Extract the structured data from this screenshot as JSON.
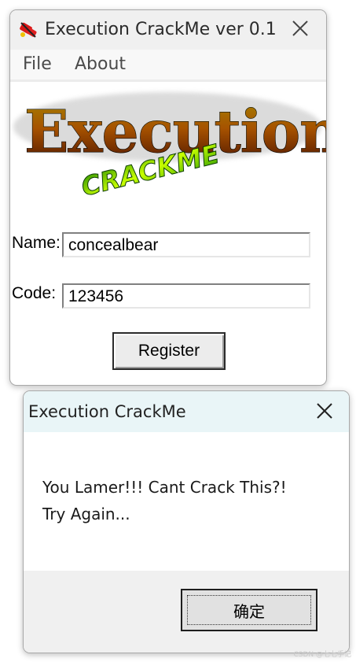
{
  "main_window": {
    "title": "Execution CrackMe ver 0.1",
    "menu": [
      "File",
      "About"
    ],
    "logo": {
      "title": "Execution",
      "subtitle": "CRACKME"
    },
    "name_label": "Name:",
    "name_value": "concealbear",
    "code_label": "Code:",
    "code_value": "123456",
    "register_label": "Register"
  },
  "dialog": {
    "title": "Execution CrackMe",
    "message_line1": "You Lamer!!! Cant Crack This?!",
    "message_line2": "Try Again...",
    "ok_label": "确定"
  },
  "watermark": "CSDN @七七手记",
  "colors": {
    "dialog_titlebar": "#e9f5f7",
    "logo_fire": "#ff8a00",
    "logo_green": "#3cb800"
  },
  "icons": [
    "app-crackme-icon",
    "close-icon"
  ]
}
